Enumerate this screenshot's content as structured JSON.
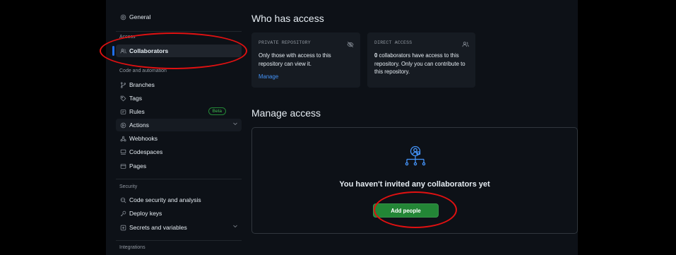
{
  "sidebar": {
    "general_label": "General",
    "access_heading": "Access",
    "collaborators_label": "Collaborators",
    "code_automation_heading": "Code and automation",
    "items": [
      {
        "label": "Branches",
        "icon": "branch-icon"
      },
      {
        "label": "Tags",
        "icon": "tag-icon"
      },
      {
        "label": "Rules",
        "icon": "rules-icon",
        "badge": "Beta"
      },
      {
        "label": "Actions",
        "icon": "play-icon"
      },
      {
        "label": "Webhooks",
        "icon": "webhook-icon"
      },
      {
        "label": "Codespaces",
        "icon": "codespaces-icon"
      },
      {
        "label": "Pages",
        "icon": "pages-icon"
      }
    ],
    "security_heading": "Security",
    "security_items": [
      {
        "label": "Code security and analysis",
        "icon": "codescan-icon"
      },
      {
        "label": "Deploy keys",
        "icon": "key-icon"
      },
      {
        "label": "Secrets and variables",
        "icon": "secret-icon"
      }
    ],
    "integrations_heading": "Integrations"
  },
  "main": {
    "who_has_access_title": "Who has access",
    "private_card": {
      "caption": "PRIVATE REPOSITORY",
      "text": "Only those with access to this repository can view it.",
      "link": "Manage"
    },
    "direct_card": {
      "caption": "DIRECT ACCESS",
      "count": "0",
      "text": " collaborators have access to this repository. Only you can contribute to this repository."
    },
    "manage_access_title": "Manage access",
    "blankslate_title": "You haven't invited any collaborators yet",
    "add_people_label": "Add people"
  },
  "colors": {
    "background": "#0d1117",
    "card": "#161b22",
    "accent": "#4493f8",
    "primary_button": "#238636",
    "annotation": "#e01111"
  }
}
